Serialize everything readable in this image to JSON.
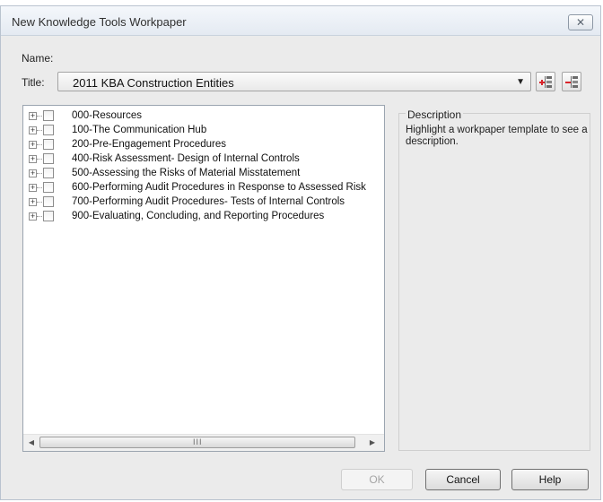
{
  "window": {
    "title": "New Knowledge Tools Workpaper",
    "close_glyph": "✕"
  },
  "form": {
    "name_label": "Name:",
    "title_label": "Title:",
    "title_value": "2011 KBA Construction Entities"
  },
  "tree": {
    "items": [
      {
        "label": "000-Resources"
      },
      {
        "label": "100-The Communication Hub"
      },
      {
        "label": "200-Pre-Engagement Procedures"
      },
      {
        "label": "400-Risk Assessment- Design of Internal Controls"
      },
      {
        "label": "500-Assessing the Risks of Material Misstatement"
      },
      {
        "label": "600-Performing Audit Procedures in Response to Assessed Risk"
      },
      {
        "label": "700-Performing Audit Procedures- Tests of Internal Controls"
      },
      {
        "label": "900-Evaluating, Concluding, and Reporting Procedures"
      }
    ],
    "scroll_left_glyph": "◀",
    "scroll_right_glyph": "▶",
    "scroll_grip": "III"
  },
  "description": {
    "title": "Description",
    "text": "Highlight a workpaper template to see a description."
  },
  "buttons": {
    "ok": "OK",
    "cancel": "Cancel",
    "help": "Help"
  },
  "icons": {
    "add_template": "add-template-icon",
    "remove_template": "remove-template-icon",
    "add_color": "#d9242a",
    "remove_color": "#d9242a"
  }
}
